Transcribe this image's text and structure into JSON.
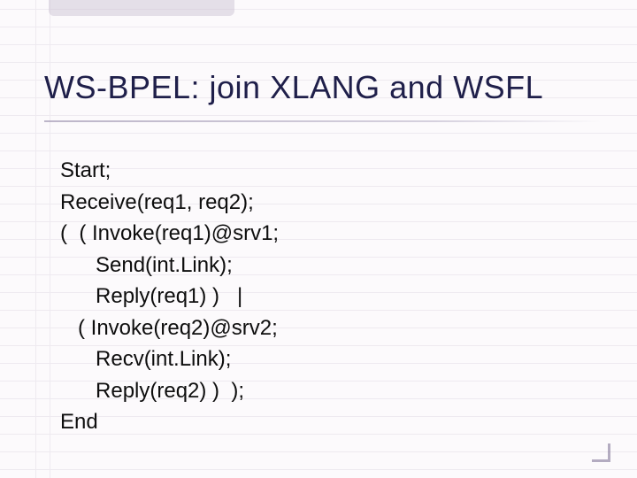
{
  "title": "WS-BPEL: join XLANG and WSFL",
  "body_text": "Start;\nReceive(req1, req2);\n(  ( Invoke(req1)@srv1;\n      Send(int.Link);\n      Reply(req1) )   |\n   ( Invoke(req2)@srv2;\n      Recv(int.Link);\n      Reply(req2) )  );\nEnd",
  "code_lines": [
    "Start;",
    "Receive(req1, req2);",
    "(  ( Invoke(req1)@srv1;",
    "      Send(int.Link);",
    "      Reply(req1) )   |",
    "   ( Invoke(req2)@srv2;",
    "      Recv(int.Link);",
    "      Reply(req2) )  );",
    "End"
  ]
}
